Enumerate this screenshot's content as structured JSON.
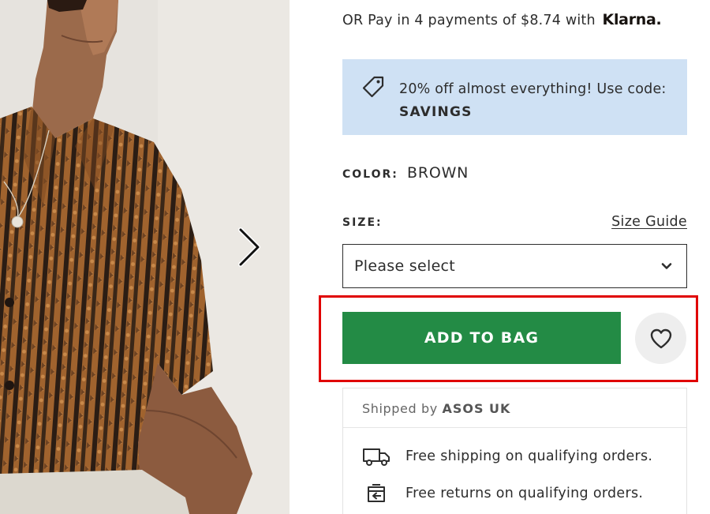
{
  "product_image": {
    "alt": "Model wearing brown striped crochet short-sleeve shirt"
  },
  "gallery": {
    "next_icon": "chevron-right-icon"
  },
  "payment": {
    "text": "OR Pay in 4 payments of $8.74 with",
    "provider": "Klarna."
  },
  "promo": {
    "icon": "tag-icon",
    "text": "20% off almost everything! Use code:",
    "code": "SAVINGS",
    "background": "#cfe1f4"
  },
  "color": {
    "label": "COLOR:",
    "value": "BROWN"
  },
  "size": {
    "label": "SIZE:",
    "guide_link": "Size Guide",
    "selected": "Please select",
    "chevron_icon": "chevron-down-icon"
  },
  "actions": {
    "add_to_bag": "ADD TO BAG",
    "add_to_bag_color": "#238b45",
    "save_icon": "heart-icon",
    "highlight_color": "#e00000"
  },
  "delivery": {
    "shipped_by_prefix": "Shipped by",
    "shipped_by_seller": "ASOS UK",
    "items": [
      {
        "icon": "truck-icon",
        "text": "Free shipping on qualifying orders."
      },
      {
        "icon": "returns-icon",
        "text": "Free returns on qualifying orders."
      }
    ]
  }
}
